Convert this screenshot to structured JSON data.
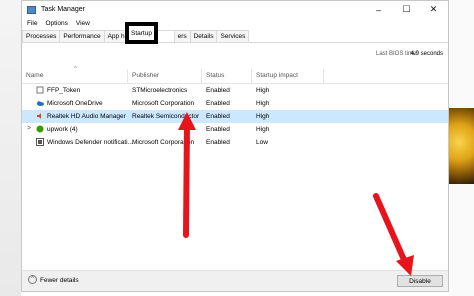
{
  "window": {
    "title": "Task Manager"
  },
  "window_controls": [
    "–",
    "☐",
    "✕"
  ],
  "menu": [
    "File",
    "Options",
    "View"
  ],
  "tabs": [
    "Processes",
    "Performance",
    "App histo",
    "Startup",
    "ers",
    "Details",
    "Services"
  ],
  "active_tab": "Startup",
  "bios": {
    "label": "Last BIOS time:",
    "value": "4.9 seconds"
  },
  "columns": [
    "Name",
    "Publisher",
    "Status",
    "Startup impact"
  ],
  "rows": [
    {
      "name": "FFP_Token",
      "publisher": "STMicroelectronics",
      "status": "Enabled",
      "impact": "High",
      "icon": "token-icon",
      "selected": false
    },
    {
      "name": "Microsoft OneDrive",
      "publisher": "Microsoft Corporation",
      "status": "Enabled",
      "impact": "High",
      "icon": "cloud-icon",
      "selected": false
    },
    {
      "name": "Realtek HD Audio Manager",
      "publisher": "Realtek Semiconductor",
      "status": "Enabled",
      "impact": "High",
      "icon": "speaker-icon",
      "selected": true
    },
    {
      "name": "upwork (4)",
      "publisher": "",
      "status": "Enabled",
      "impact": "High",
      "icon": "upwork-icon",
      "selected": false
    },
    {
      "name": "Windows Defender notificati...",
      "publisher": "Microsoft Corporation",
      "status": "Enabled",
      "impact": "Low",
      "icon": "shield-icon",
      "selected": false
    }
  ],
  "footer": {
    "fewer_details": "Fewer details",
    "disable": "Disable"
  },
  "colors": {
    "selected_row": "#cce8ff",
    "annotation_red": "#e8141b",
    "callout_border": "#000000"
  }
}
